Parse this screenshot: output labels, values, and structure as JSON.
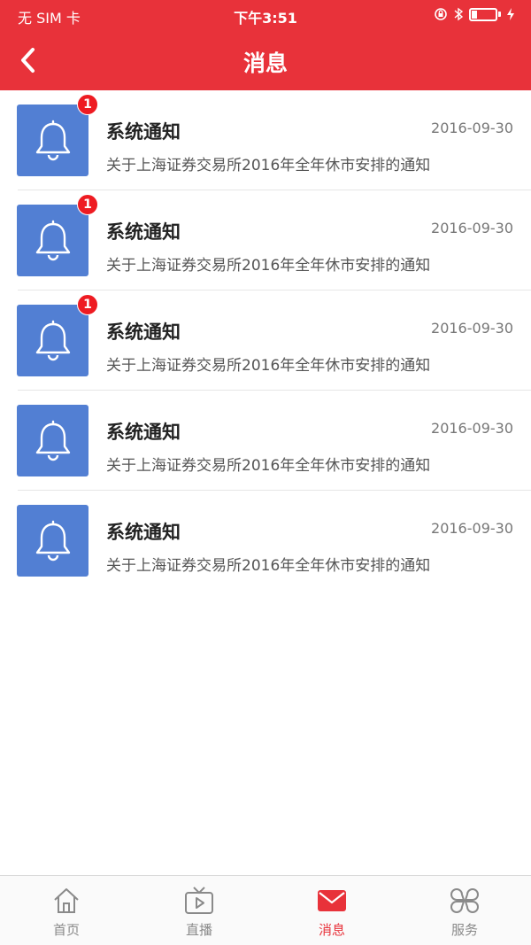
{
  "status_bar": {
    "carrier": "无 SIM 卡",
    "time": "下午3:51"
  },
  "nav": {
    "title": "消息",
    "back_icon": "chevron-left-icon"
  },
  "colors": {
    "primary": "#e8323a",
    "icon_bg": "#527fd3",
    "badge": "#ee1b22"
  },
  "messages": [
    {
      "title": "系统通知",
      "date": "2016-09-30",
      "desc": "关于上海证券交易所2016年全年休市安排的通知",
      "badge": "1",
      "icon": "bell-icon"
    },
    {
      "title": "系统通知",
      "date": "2016-09-30",
      "desc": "关于上海证券交易所2016年全年休市安排的通知",
      "badge": "1",
      "icon": "bell-icon"
    },
    {
      "title": "系统通知",
      "date": "2016-09-30",
      "desc": "关于上海证券交易所2016年全年休市安排的通知",
      "badge": "1",
      "icon": "bell-icon"
    },
    {
      "title": "系统通知",
      "date": "2016-09-30",
      "desc": "关于上海证券交易所2016年全年休市安排的通知",
      "badge": "",
      "icon": "bell-icon"
    },
    {
      "title": "系统通知",
      "date": "2016-09-30",
      "desc": "关于上海证券交易所2016年全年休市安排的通知",
      "badge": "",
      "icon": "bell-icon"
    }
  ],
  "tabbar": {
    "items": [
      {
        "label": "首页",
        "icon": "home-icon",
        "active": false
      },
      {
        "label": "直播",
        "icon": "tv-play-icon",
        "active": false
      },
      {
        "label": "消息",
        "icon": "mail-icon",
        "active": true
      },
      {
        "label": "服务",
        "icon": "grid-services-icon",
        "active": false
      }
    ]
  }
}
